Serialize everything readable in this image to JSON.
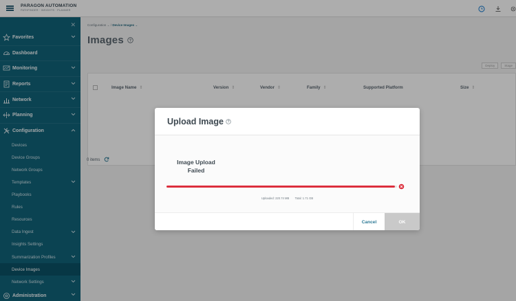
{
  "brand": {
    "name": "PARAGON AUTOMATION",
    "tagline": "PATHFINDER · INSIGHTS · PLANNER"
  },
  "sidebar": {
    "items": [
      {
        "label": "Favorites",
        "icon": "star-icon",
        "expandable": true
      },
      {
        "label": "Dashboard",
        "icon": "dashboard-icon",
        "expandable": false
      },
      {
        "label": "Monitoring",
        "icon": "monitor-icon",
        "expandable": true
      },
      {
        "label": "Reports",
        "icon": "report-icon",
        "expandable": true
      },
      {
        "label": "Network",
        "icon": "network-icon",
        "expandable": true
      },
      {
        "label": "Planning",
        "icon": "planning-icon",
        "expandable": true
      },
      {
        "label": "Configuration",
        "icon": "tools-icon",
        "expandable": true,
        "expanded": true
      }
    ],
    "config_children": [
      {
        "label": "Devices"
      },
      {
        "label": "Device Groups"
      },
      {
        "label": "Network Groups"
      },
      {
        "label": "Templates",
        "expandable": true
      },
      {
        "label": "Playbooks"
      },
      {
        "label": "Rules"
      },
      {
        "label": "Resources"
      },
      {
        "label": "Data Ingest",
        "expandable": true
      },
      {
        "label": "Insights Settings"
      },
      {
        "label": "Summarization Profiles",
        "expandable": true
      },
      {
        "label": "Device Images",
        "active": true
      },
      {
        "label": "Network Settings",
        "expandable": true
      }
    ],
    "bottom_item": {
      "label": "Administration",
      "icon": "admin-gear-icon",
      "expandable": true
    }
  },
  "breadcrumb": {
    "parent": "Configuration",
    "separator": "/",
    "current": "Device Images"
  },
  "page": {
    "title": "Images",
    "toolbar_buttons": [
      "Deploy",
      "Stage"
    ]
  },
  "table": {
    "columns": [
      "Image Name",
      "Version",
      "Vendor",
      "Family",
      "Supported Platform",
      "Size"
    ],
    "count_text": "0 items"
  },
  "modal": {
    "title": "Upload Image",
    "status_line1": "Image Upload",
    "status_line2": "Failed",
    "progress": 0.99,
    "uploaded_label": "Uploaded:",
    "uploaded_value": "220.74 MB",
    "total_label": "Total:",
    "total_value": "1.71 GB",
    "cancel_label": "Cancel",
    "ok_label": "OK"
  },
  "colors": {
    "sidebar": "#11637a",
    "accent": "#2d7a96",
    "error": "#dc2e3c"
  }
}
